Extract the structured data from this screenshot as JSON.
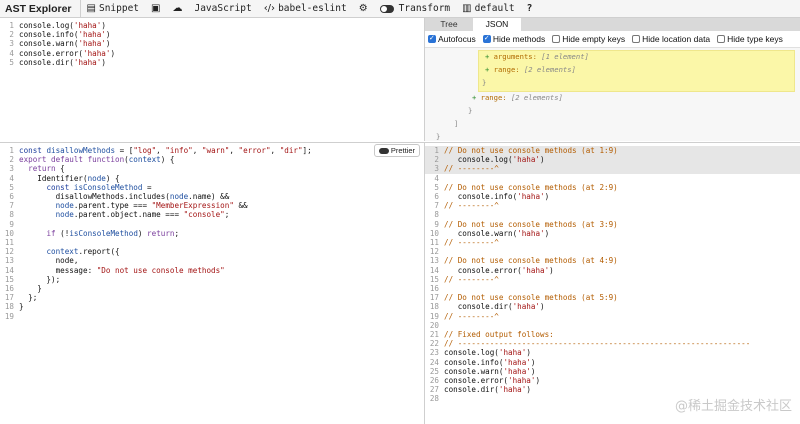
{
  "toolbar": {
    "brand": "AST Explorer",
    "snippet": "Snippet",
    "language": "JavaScript",
    "parser": "babel-eslint",
    "transform": "Transform",
    "transformer": "default",
    "help": "?"
  },
  "source": {
    "numbers": "1\n2\n3\n4\n5"
  },
  "tree_panel": {
    "tabs": [
      "Tree",
      "JSON"
    ],
    "options": [
      {
        "label": "Autofocus",
        "checked": true
      },
      {
        "label": "Hide methods",
        "checked": true
      },
      {
        "label": "Hide empty keys",
        "checked": false
      },
      {
        "label": "Hide location data",
        "checked": false
      },
      {
        "label": "Hide type keys",
        "checked": false
      }
    ],
    "nodes": {
      "arguments_key": "arguments:",
      "arguments_val": "[1 element]",
      "range1_key": "range:",
      "range1_val": "[2 elements]",
      "range2_key": "range:",
      "range2_val": "[2 elements]"
    }
  },
  "transform_panel": {
    "prettier_label": "Prettier",
    "numbers": "1\n2\n3\n4\n5\n6\n7\n8\n9\n10\n11\n12\n13\n14\n15\n16\n17\n18\n19"
  },
  "output": {
    "numbers": "1\n2\n3\n4\n5\n6\n7\n8\n9\n10\n11\n12\n13\n14\n15\n16\n17\n18\n19\n20\n21\n22\n23\n24\n25\n26\n27\n28"
  },
  "watermark": "@稀土掘金技术社区"
}
